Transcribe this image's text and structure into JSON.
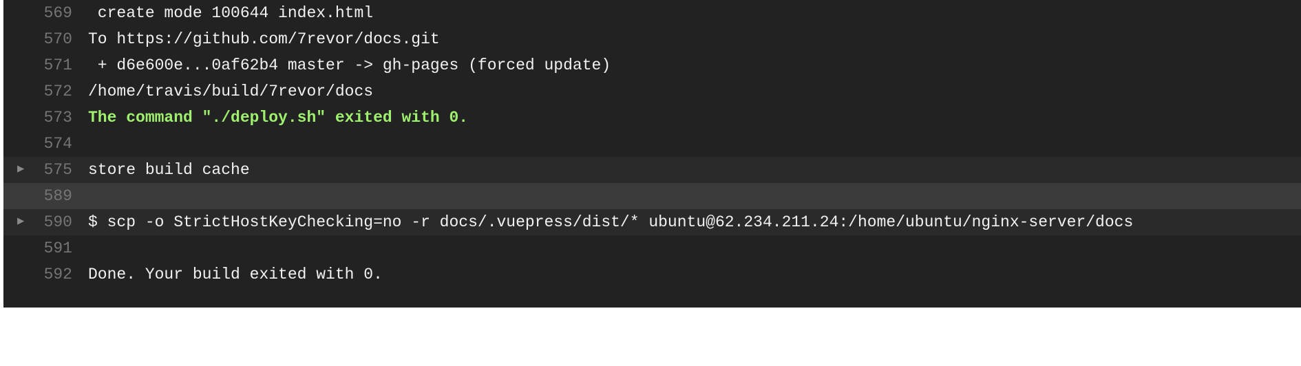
{
  "log": {
    "lines": [
      {
        "number": "569",
        "text": " create mode 100644 index.html"
      },
      {
        "number": "570",
        "text": "To https://github.com/7revor/docs.git"
      },
      {
        "number": "571",
        "text": " + d6e600e...0af62b4 master -> gh-pages (forced update)"
      },
      {
        "number": "572",
        "text": "/home/travis/build/7revor/docs"
      },
      {
        "number": "573",
        "text": "The command \"./deploy.sh\" exited with 0."
      },
      {
        "number": "574",
        "text": ""
      },
      {
        "number": "575",
        "text": "store build cache"
      },
      {
        "number": "589",
        "text": ""
      },
      {
        "number": "590",
        "text": "$ scp -o StrictHostKeyChecking=no -r docs/.vuepress/dist/* ubuntu@62.234.211.24:/home/ubuntu/nginx-server/docs"
      },
      {
        "number": "591",
        "text": ""
      },
      {
        "number": "592",
        "text": "Done. Your build exited with 0."
      }
    ],
    "fold_arrow_glyph": "▶"
  },
  "colors": {
    "panel_background": "#222222",
    "text": "#f1f1f1",
    "line_number": "#757575",
    "success": "#9ff06e",
    "fold_row_background": "#2a2a2a",
    "highlight_row_background": "#3b3b3b"
  }
}
